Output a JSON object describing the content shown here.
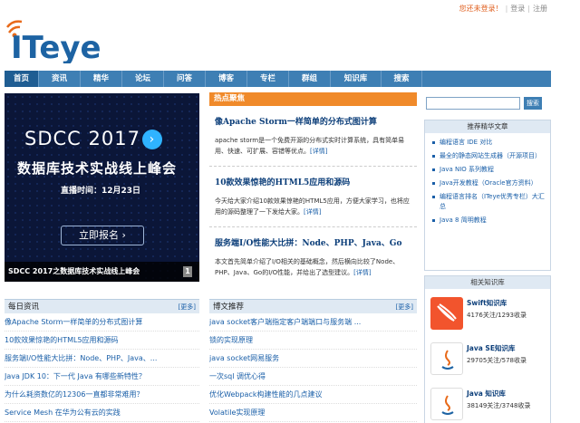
{
  "topbar": {
    "warning": "您还未登录！",
    "login": "登录",
    "sep": "|",
    "register": "注册"
  },
  "logo": {
    "text": "ITeye"
  },
  "nav": {
    "items": [
      {
        "label": "首页",
        "active": true
      },
      {
        "label": "资讯"
      },
      {
        "label": "精华"
      },
      {
        "label": "论坛"
      },
      {
        "label": "问答"
      },
      {
        "label": "博客"
      },
      {
        "label": "专栏"
      },
      {
        "label": "群组"
      },
      {
        "label": "知识库"
      },
      {
        "label": "搜索"
      }
    ]
  },
  "banner": {
    "brand": "SDCC 2017",
    "headline": "数据库技术实战线上峰会",
    "live": "直播时间：12月23日",
    "button": "立即报名",
    "caption": "SDCC 2017之数据库技术实战线上峰会",
    "page_label": "1"
  },
  "hot": {
    "title": "热点聚焦",
    "articles": [
      {
        "title": "像Apache Storm一样简单的分布式图计算",
        "desc": "apache storm是一个免费开源的分布式实时计算系统，具有简单易用、快速、可扩展、容错等优点。",
        "more": "[详情]"
      },
      {
        "title": "10款效果惊艳的HTML5应用和源码",
        "desc": "今天给大家介绍10款效果惊艳的HTML5应用，方便大家学习，也将应用的源码整理了一下发给大家。",
        "more": "[详情]"
      },
      {
        "title": "服务端I/O性能大比拼：Node、PHP、Java、Go",
        "desc": "本文首先简单介绍了I/O相关的基础概念，然后横向比较了Node、PHP、Java、Go的I/O性能，并给出了选型建议。",
        "more": "[详情]"
      }
    ]
  },
  "search": {
    "button": "搜索"
  },
  "recommend": {
    "title": "推荐精华文章",
    "items": [
      "编程语言 IDE 对比",
      "最全的静态网站生成器（开源项目）",
      "Java NIO 系列教程",
      "Java开发教程（Oracle官方资料）",
      "编程语言排名（ITeye优秀专栏）大汇总",
      "Java 8 简明教程"
    ]
  },
  "knowledge": {
    "title": "相关知识库",
    "items": [
      {
        "name": "Swift知识库",
        "count": "4176关注/1293收录"
      },
      {
        "name": "Java SE知识库",
        "count": "29705关注/578收录"
      },
      {
        "name": "Java 知识库",
        "count": "38149关注/3748收录"
      }
    ]
  },
  "daily": {
    "title": "每日资讯",
    "more": "[更多]",
    "items": [
      "像Apache Storm一样简单的分布式图计算",
      "10款效果惊艳的HTML5应用和源码",
      "服务端I/O性能大比拼：Node、PHP、Java、...",
      "Java JDK 10：下一代 Java 有哪些新特性？",
      "为什么耗资数亿的12306一直都非常难用？",
      "Service Mesh 在华为公有云的实践"
    ]
  },
  "blogs": {
    "title": "博文推荐",
    "more": "[更多]",
    "items": [
      "java socket客户端指定客户端端口与服务端 ...",
      "锁的实现原理",
      "java socket网易服务",
      "一次sql 调优心得",
      "优化Webpack构建性能的几点建议",
      "Volatile实现原理"
    ]
  },
  "colors": {
    "nav": "#3e7fb4",
    "hot_header": "#f08a2a",
    "link": "#1a5fa8"
  }
}
